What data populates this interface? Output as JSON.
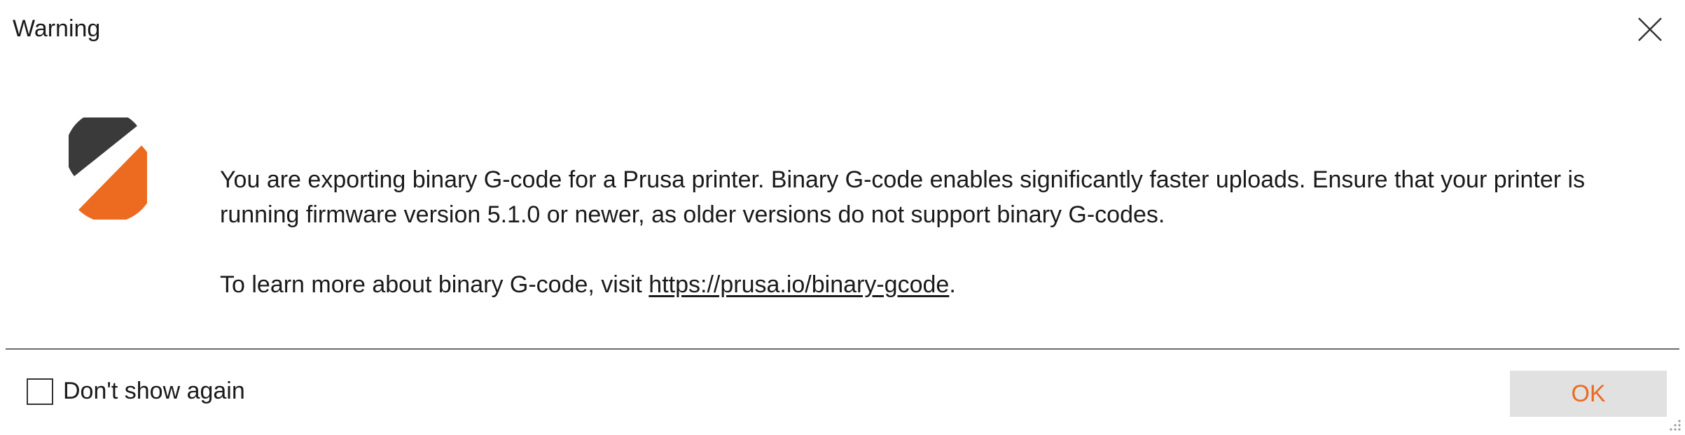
{
  "dialog": {
    "title": "Warning",
    "close_icon": "close-icon",
    "logo_icon": "prusaslicer-logo",
    "message": {
      "paragraph1": "You are exporting binary G-code for a Prusa printer. Binary G-code enables significantly faster uploads. Ensure that your printer is running firmware version 5.1.0 or newer, as older versions do not support binary G-codes.",
      "paragraph2_prefix": "To learn more about binary G-code, visit ",
      "link_text": "https://prusa.io/binary-gcode",
      "paragraph2_suffix": "."
    },
    "checkbox": {
      "label": "Don't show again",
      "checked": false
    },
    "ok_label": "OK"
  },
  "colors": {
    "accent": "#ec6b21",
    "logo_dark": "#3a3a3a",
    "button_bg": "#e1e1e1"
  }
}
